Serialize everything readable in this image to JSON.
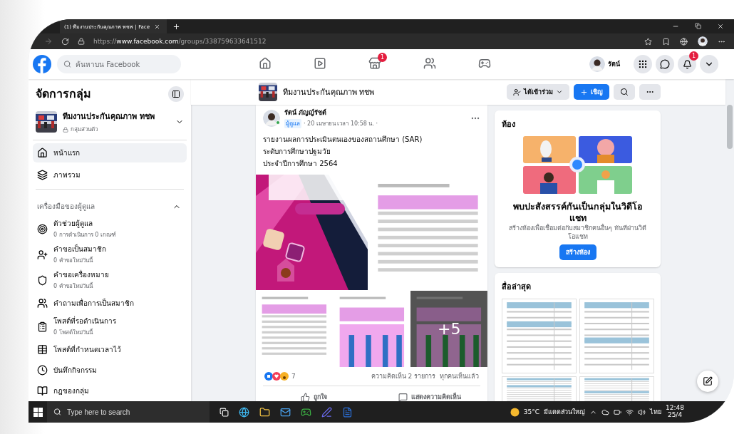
{
  "browser": {
    "tab_title": "(1) ทีมงานประกันคุณภาพ ทชพ | Face",
    "url": "https://**www.facebook.com**/groups/338759633641512"
  },
  "nav": {
    "search_placeholder": "ค้นหาบน Facebook",
    "tabs": [
      {
        "kind": "home",
        "selected": false
      },
      {
        "kind": "video",
        "selected": false
      },
      {
        "kind": "store",
        "selected": false,
        "badge": "1"
      },
      {
        "kind": "groups",
        "selected": false
      },
      {
        "kind": "gaming",
        "selected": false
      }
    ],
    "profile_name": "รัตน์",
    "notification_badge": "1"
  },
  "sidebar": {
    "title": "จัดการกลุ่ม",
    "group_name": "ทีมงานประกันคุณภาพ ทชพ",
    "privacy": "กลุ่มส่วนตัว",
    "items": [
      {
        "label": "หน้าแรก",
        "selected": true
      },
      {
        "label": "ภาพรวม",
        "selected": false
      }
    ],
    "admin_tools": {
      "title": "เครื่องมือของผู้ดูแล",
      "expanded": true,
      "items": [
        {
          "label": "ตัวช่วยผู้ดูแล",
          "sub": "0 การดำเนินการ 0 เกณฑ์"
        },
        {
          "label": "คำขอเป็นสมาชิก",
          "sub": "0 คำขอใหม่วันนี้"
        },
        {
          "label": "คำขอเครื่องหมาย",
          "sub": "0 คำขอใหม่วันนี้"
        },
        {
          "label": "คำถามเพื่อการเป็นสมาชิก"
        },
        {
          "label": "โพสต์ที่รอดำเนินการ",
          "sub": "0 โพสต์ใหม่วันนี้"
        },
        {
          "label": "โพสต์ที่กำหนดเวลาไว้"
        },
        {
          "label": "บันทึกกิจกรรม"
        },
        {
          "label": "กฎของกลุ่ม"
        }
      ]
    }
  },
  "group_header": {
    "name": "ทีมงานประกันคุณภาพ ทชพ",
    "joined_label": "ได้เข้าร่วม",
    "invite_label": "เชิญ"
  },
  "post": {
    "author": "รัตน์ ภัญญ์รัชต์",
    "role": "ผู้ดูแล",
    "time": "· 20 เมษายน เวลา 10:58 น. ·",
    "online": true,
    "text_lines": [
      "รายงานผลการประเมินตนเองของสถานศึกษา (SAR)",
      "ระดับการศึกษาปฐมวัย",
      "ประจำปีการศึกษา 2564"
    ],
    "more_images": "+5",
    "reaction_count": "7",
    "comments": "ความคิดเห็น 2 รายการ",
    "seen": "ทุกคนเห็นแล้ว",
    "like_label": "ถูกใจ",
    "comment_label": "แสดงความคิดเห็น"
  },
  "rooms": {
    "title": "ห้อง",
    "heading": "พบปะสังสรรค์กันเป็นกลุ่มในวิดีโอแชท",
    "text": "สร้างห้องเพื่อเชื่อมต่อกับสมาชิกคนอื่นๆ ทันทีผ่านวิดีโอแชท",
    "button": "สร้างห้อง"
  },
  "media": {
    "title": "สื่อล่าสุด"
  },
  "taskbar": {
    "search_placeholder": "Type here to search",
    "temperature": "35°C",
    "weather": "มีแดดส่วนใหญ่",
    "language": "ไทย",
    "time": "12:48",
    "date": "25/4"
  }
}
